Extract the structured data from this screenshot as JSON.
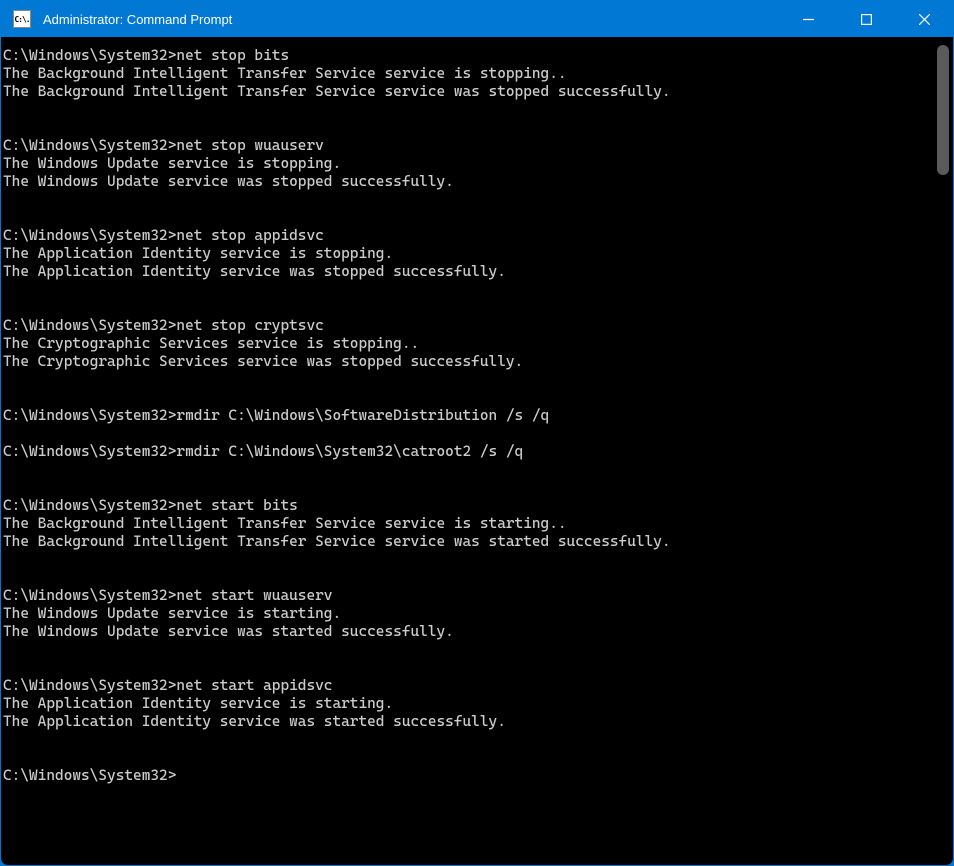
{
  "window": {
    "title": "Administrator: Command Prompt",
    "icon_label": "C:\\."
  },
  "prompt": "C:\\Windows\\System32>",
  "blocks": [
    {
      "command": "net stop bits",
      "output": [
        "The Background Intelligent Transfer Service service is stopping..",
        "The Background Intelligent Transfer Service service was stopped successfully."
      ]
    },
    {
      "command": "net stop wuauserv",
      "output": [
        "The Windows Update service is stopping.",
        "The Windows Update service was stopped successfully."
      ]
    },
    {
      "command": "net stop appidsvc",
      "output": [
        "The Application Identity service is stopping.",
        "The Application Identity service was stopped successfully."
      ]
    },
    {
      "command": "net stop cryptsvc",
      "output": [
        "The Cryptographic Services service is stopping..",
        "The Cryptographic Services service was stopped successfully."
      ]
    },
    {
      "command": "rmdir C:\\Windows\\SoftwareDistribution /s /q",
      "output": []
    },
    {
      "command": "rmdir C:\\Windows\\System32\\catroot2 /s /q",
      "output": []
    },
    {
      "command": "net start bits",
      "output": [
        "The Background Intelligent Transfer Service service is starting..",
        "The Background Intelligent Transfer Service service was started successfully."
      ]
    },
    {
      "command": "net start wuauserv",
      "output": [
        "The Windows Update service is starting.",
        "The Windows Update service was started successfully."
      ]
    },
    {
      "command": "net start appidsvc",
      "output": [
        "The Application Identity service is starting.",
        "The Application Identity service was started successfully."
      ]
    },
    {
      "command": "",
      "output": []
    }
  ]
}
